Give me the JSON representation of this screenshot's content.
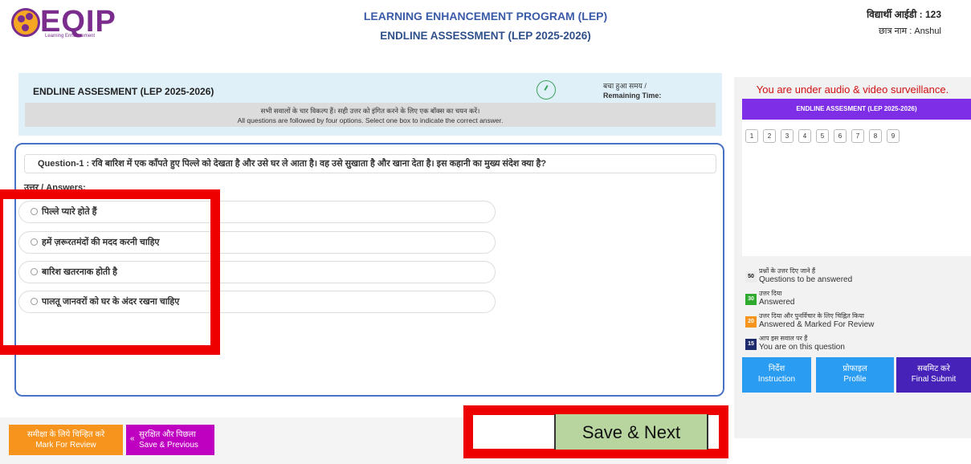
{
  "header": {
    "logo_text": "EQIP",
    "logo_sub": "Learning Enhancement",
    "title_line1": "LEARNING ENHANCEMENT PROGRAM (LEP)",
    "title_line2": "ENDLINE ASSESSMENT (LEP 2025-2026)",
    "student_id": "विद्यार्थी आईडी : 123",
    "student_name": "छात्र नाम : Anshul"
  },
  "exam": {
    "name": "ENDLINE ASSESMENT (LEP 2025-2026)",
    "remaining_hi": "बचा हुआ समय /",
    "remaining_en": "Remaining Time:",
    "instruction_hi": "सभी सवालों के चार विकल्प हैं। सही उत्तर को इंगित करने के लिए एक बॉक्स का चयन करें।",
    "instruction_en": "All questions are followed by four options. Select one box to indicate the correct answer."
  },
  "question": {
    "text": "Question-1 : रवि बारिश में एक काँपते हुए पिल्ले को देखता है और उसे घर ले आता है। वह उसे सुखाता है और खाना देता है। इस कहानी का मुख्य संदेश क्या है?",
    "answers_label": "उत्तर / Answers:",
    "options": [
      "पिल्ले प्यारे होते हैं",
      "हमें ज़रूरतमंदों की मदद करनी चाहिए",
      "बारिश खतरनाक होती है",
      "पालतू जानवरों को घर के अंदर रखना चाहिए"
    ]
  },
  "buttons": {
    "review_hi": "समीक्षा के लिये चिन्हित करे",
    "review_en": "Mark For Review",
    "prev_hi": "सुरक्षित और पिछला",
    "prev_en": "Save & Previous",
    "save_next": "Save & Next"
  },
  "panel": {
    "surveillance": "You are under audio & video surveillance.",
    "card_title": "ENDLINE ASSESMENT (LEP 2025-2026)",
    "question_numbers": [
      "1",
      "2",
      "3",
      "4",
      "5",
      "6",
      "7",
      "8",
      "9"
    ],
    "legend": [
      {
        "count": "50",
        "hi": "प्रश्नों के उत्तर दिए जाने हैं",
        "en": "Questions to be answered",
        "color": "#ececec"
      },
      {
        "count": "30",
        "hi": "उत्तर दिया",
        "en": "Answered",
        "color": "#2eaa2e"
      },
      {
        "count": "20",
        "hi": "उत्तर दिया और पुनर्विचार के लिए चिह्नित किया",
        "en": "Answered & Marked For Review",
        "color": "#f7941d"
      },
      {
        "count": "15",
        "hi": "आप इस सवाल पर हैं",
        "en": "You are on this question",
        "color": "#1d2a6b"
      }
    ],
    "instruction_hi": "निर्देश",
    "instruction_en": "Instruction",
    "profile_hi": "प्रोफाइल",
    "profile_en": "Profile",
    "submit_hi": "सबमिट करे",
    "submit_en": "Final Submit"
  }
}
